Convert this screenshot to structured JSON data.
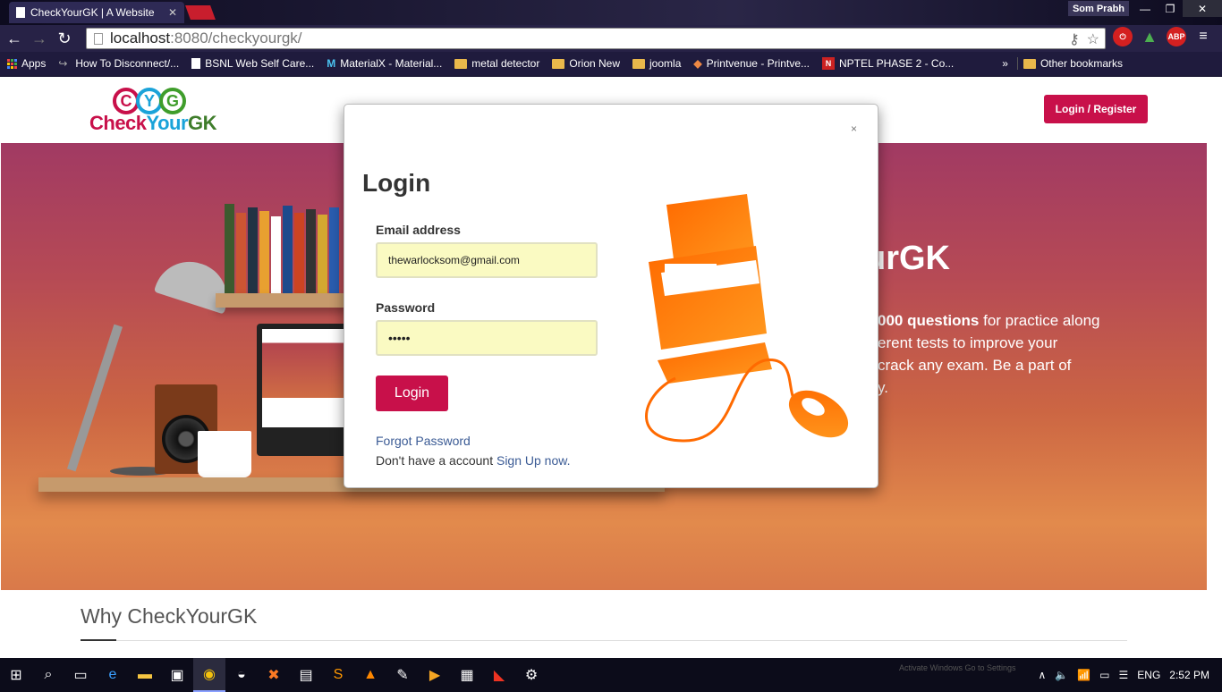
{
  "browser": {
    "tab_title": "CheckYourGK | A Website",
    "user": "Som Prabh",
    "url_host": "localhost",
    "url_rest": ":8080/checkyourgk/",
    "bookmarks": [
      {
        "label": "Apps",
        "type": "apps"
      },
      {
        "label": "How To Disconnect/...",
        "type": "link"
      },
      {
        "label": "BSNL Web Self Care...",
        "type": "doc"
      },
      {
        "label": "MaterialX - Material...",
        "type": "link"
      },
      {
        "label": "metal detector",
        "type": "folder"
      },
      {
        "label": "Orion New",
        "type": "folder"
      },
      {
        "label": "joomla",
        "type": "folder"
      },
      {
        "label": "Printvenue - Printve...",
        "type": "link"
      },
      {
        "label": "NPTEL PHASE 2 - Co...",
        "type": "link"
      }
    ],
    "overflow": "»",
    "other_bookmarks": "Other bookmarks"
  },
  "site": {
    "logo_letters": [
      "C",
      "Y",
      "G"
    ],
    "logo_text_a": "Check",
    "logo_text_b": "Your",
    "logo_text_c": "GK",
    "login_register": "Login / Register",
    "hero_title_partial": "urGK",
    "hero_text_1_bold": "000 questions",
    "hero_text_1": " for practice along",
    "hero_text_2": "erent tests to improve your",
    "hero_text_3": "crack any exam. Be a part of",
    "hero_text_4": "y.",
    "why_title": "Why CheckYourGK"
  },
  "modal": {
    "close": "×",
    "title": "Login",
    "email_label": "Email address",
    "email_value": "thewarlocksom@gmail.com",
    "password_label": "Password",
    "password_value": "•••••",
    "submit": "Login",
    "forgot": "Forgot Password",
    "signup_prefix": "Don't have a account ",
    "signup_link": "Sign Up now."
  },
  "taskbar": {
    "language": "ENG",
    "time": "2:52 PM",
    "watermark": "Activate Windows  Go to Settings"
  }
}
